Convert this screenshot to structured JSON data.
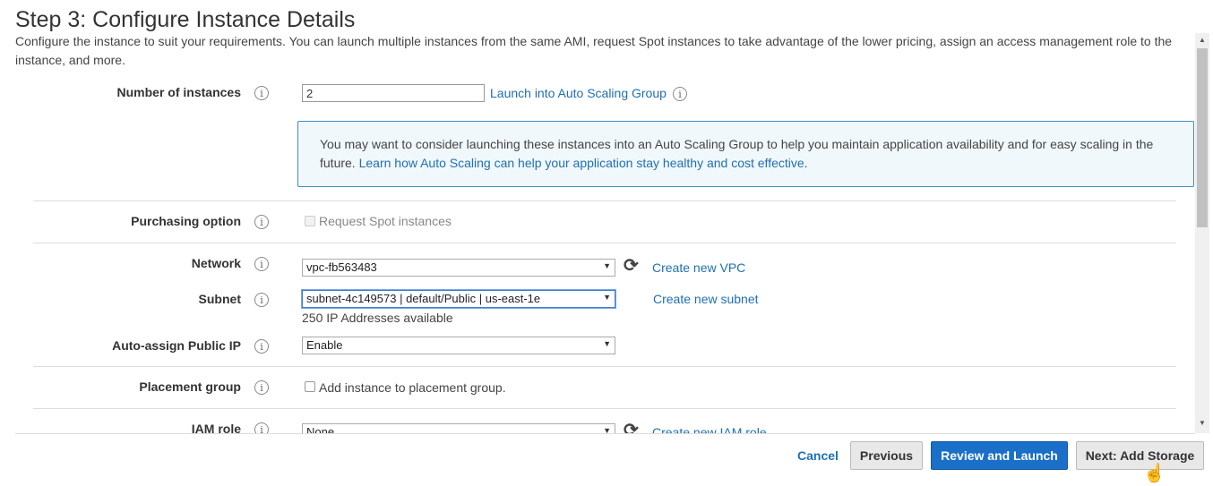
{
  "page": {
    "title": "Step 3: Configure Instance Details",
    "description": "Configure the instance to suit your requirements. You can launch multiple instances from the same AMI, request Spot instances to take advantage of the lower pricing, assign an access management role to the instance, and more."
  },
  "form": {
    "number_of_instances": {
      "label": "Number of instances",
      "value": "2",
      "asg_link": "Launch into Auto Scaling Group"
    },
    "asg_notice": {
      "text": "You may want to consider launching these instances into an Auto Scaling Group to help you maintain application availability and for easy scaling in the future.",
      "link": "Learn how Auto Scaling can help your application stay healthy and cost effective",
      "trailing": "."
    },
    "purchasing_option": {
      "label": "Purchasing option",
      "checkbox_label": "Request Spot instances",
      "checked": false,
      "disabled": true
    },
    "network": {
      "label": "Network",
      "value": "vpc-fb563483",
      "create_link": "Create new VPC"
    },
    "subnet": {
      "label": "Subnet",
      "value": "subnet-4c149573 | default/Public | us-east-1e",
      "create_link": "Create new subnet",
      "available": "250 IP Addresses available"
    },
    "auto_assign_ip": {
      "label": "Auto-assign Public IP",
      "value": "Enable"
    },
    "placement_group": {
      "label": "Placement group",
      "checkbox_label": "Add instance to placement group.",
      "checked": false
    },
    "iam_role": {
      "label": "IAM role",
      "value": "None",
      "create_link": "Create new IAM role"
    }
  },
  "icons": {
    "info": "i",
    "refresh": "⟳",
    "select_arrow": "▼",
    "scroll_up": "▲",
    "scroll_down": "▼",
    "cursor": "☝"
  },
  "footer": {
    "cancel": "Cancel",
    "previous": "Previous",
    "review_launch": "Review and Launch",
    "next": "Next: Add Storage"
  },
  "colors": {
    "primary": "#1a6fc9",
    "link": "#1f6fb2",
    "notice_border": "#3e8ebf",
    "notice_bg": "#f1f8fc"
  }
}
